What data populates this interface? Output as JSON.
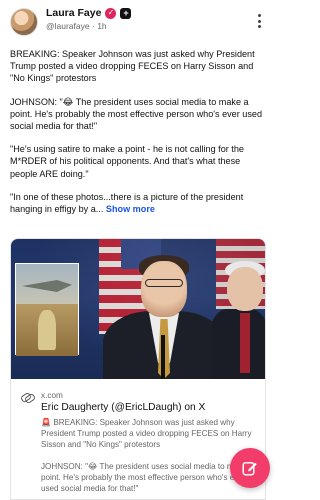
{
  "author": {
    "name": "Laura Faye",
    "handle": "@laurafaye",
    "time": "1h",
    "separator": "·",
    "verified_badge": "✓",
    "plus_badge": "+"
  },
  "post": {
    "paragraphs": [
      "BREAKING: Speaker Johnson was just asked why President Trump posted a video dropping FECES on Harry Sisson and \"No Kings\" protestors",
      "JOHNSON: \"😂 The president uses social media to make a point. He's probably the most effective person who's ever used social media for that!\"",
      "\"He's using satire to make a point - he is not calling for the M*RDER of his political opponents. And that's what these people ARE doing.\"",
      "\"In one of these photos...there is a picture of the president hanging in effigy by a..."
    ],
    "show_more": "Show more"
  },
  "link_card": {
    "domain": "x.com",
    "title": "Eric Daugherty (@EricLDaugh) on X",
    "description": [
      "🚨 BREAKING: Speaker Johnson was just asked why President Trump posted a video dropping FECES on Harry Sisson and \"No Kings\" protestors",
      "JOHNSON: \"😂 The president uses social media to make a point. He's probably the most effective person who's ever used social media for that!\""
    ]
  },
  "colors": {
    "accent": "#1a55e3",
    "fab": "#f23d6b",
    "badge": "#e0245e"
  },
  "icons": {
    "more": "vertical-ellipsis-icon",
    "link": "link-icon",
    "compose": "compose-pencil-icon"
  }
}
